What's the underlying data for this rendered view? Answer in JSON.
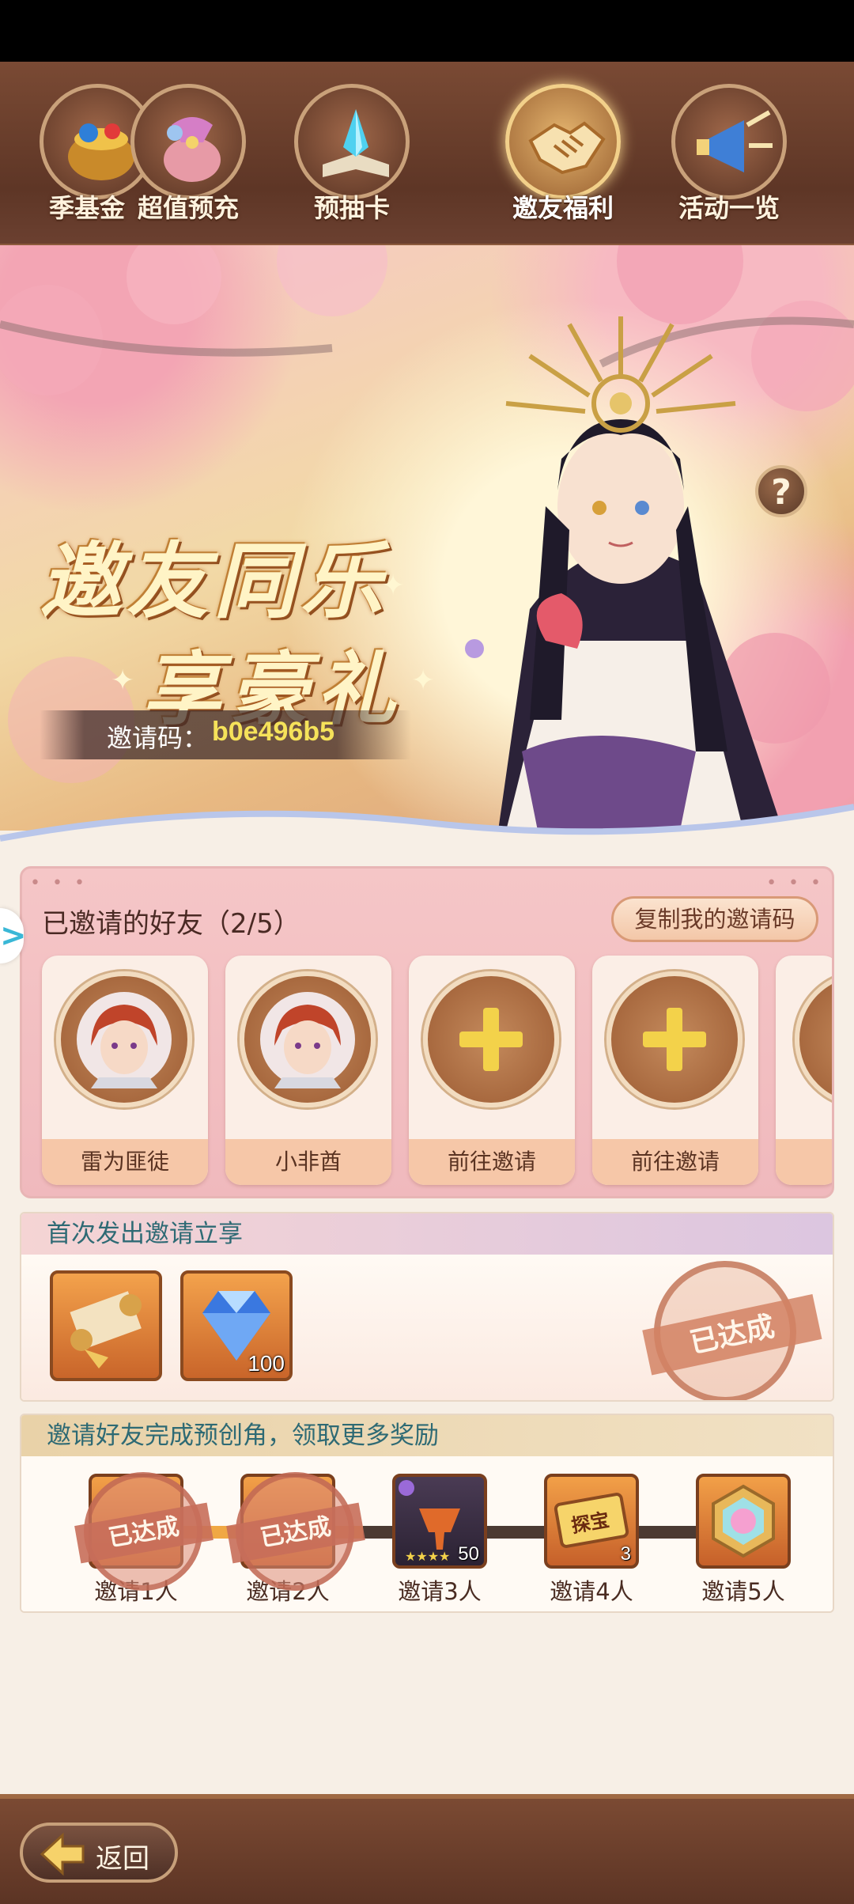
{
  "tabs": [
    {
      "label": "季基金",
      "icon": "gold-pot-icon"
    },
    {
      "label": "超值预充",
      "icon": "gift-bag-icon"
    },
    {
      "label": "预抽卡",
      "icon": "crystal-book-icon"
    },
    {
      "label": "邀友福利",
      "icon": "handshake-icon",
      "active": true
    },
    {
      "label": "活动一览",
      "icon": "megaphone-icon"
    }
  ],
  "banner": {
    "title_line1": "邀友同乐",
    "title_line2": "享豪礼",
    "invite_code_label": "邀请码：",
    "invite_code": "b0e496b5",
    "help_label": "?"
  },
  "friends": {
    "title": "已邀请的好友（2/5）",
    "copy_button": "复制我的邀请码",
    "slots": [
      {
        "name": "雷为匪徒",
        "filled": true
      },
      {
        "name": "小非酋",
        "filled": true
      },
      {
        "name": "前往邀请",
        "filled": false
      },
      {
        "name": "前往邀请",
        "filled": false
      }
    ]
  },
  "first_invite": {
    "title": "首次发出邀请立享",
    "rewards": [
      {
        "icon": "scroll-icon",
        "count": ""
      },
      {
        "icon": "diamond-icon",
        "count": "100"
      }
    ],
    "stamp": "已达成"
  },
  "milestones": {
    "title": "邀请好友完成预创角，领取更多奖励",
    "progress": 0.4,
    "items": [
      {
        "label": "邀请1人",
        "done": true,
        "stamp": "已达成"
      },
      {
        "label": "邀请2人",
        "done": true,
        "stamp": "已达成"
      },
      {
        "label": "邀请3人",
        "done": false,
        "count": "50",
        "icon": "hero-card-icon"
      },
      {
        "label": "邀请4人",
        "done": false,
        "count": "3",
        "icon": "treasure-ticket-icon",
        "ticket_text": "探宝"
      },
      {
        "label": "邀请5人",
        "done": false,
        "icon": "rainbow-gem-icon"
      }
    ]
  },
  "bottom": {
    "back_label": "返回"
  },
  "colors": {
    "accent": "#f5e25a",
    "brown": "#6e432f",
    "pink": "#f5c6c7"
  }
}
